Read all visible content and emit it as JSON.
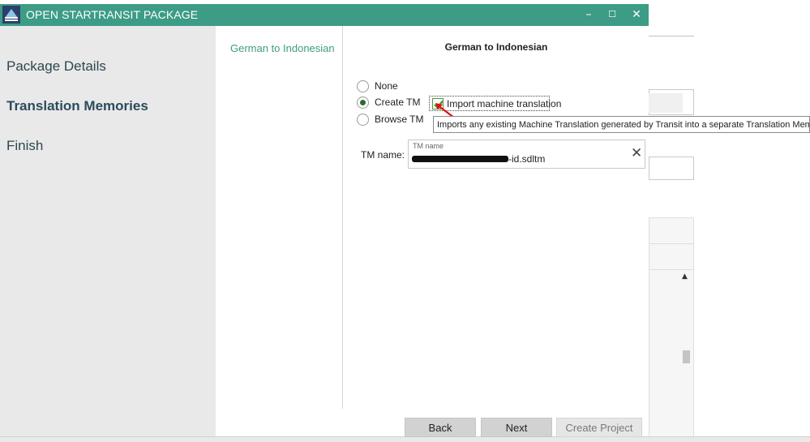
{
  "window": {
    "title": "OPEN STARTRANSIT PACKAGE",
    "minimize_glyph": "–",
    "maximize_glyph": "☐",
    "close_glyph": "✕"
  },
  "sidebar": {
    "items": [
      {
        "label": "Package Details",
        "active": false
      },
      {
        "label": "Translation Memories",
        "active": true
      },
      {
        "label": "Finish",
        "active": false
      }
    ]
  },
  "language_pairs": {
    "items": [
      "German  to Indonesian"
    ]
  },
  "content": {
    "title": "German  to Indonesian",
    "options": {
      "none": "None",
      "create": "Create TM",
      "browse": "Browse TM",
      "selected": "Create TM"
    },
    "import_mt": {
      "label": "Import machine translation",
      "checked": true,
      "tooltip": "Imports any existing Machine Translation generated by Transit into a separate Translation Memory"
    },
    "tm_name": {
      "label": "TM name:",
      "floating_label": "TM name",
      "value": "-id.sdltm",
      "clear_glyph": "✕"
    }
  },
  "buttons": {
    "back": "Back",
    "next": "Next",
    "create_project": "Create Project"
  },
  "colors": {
    "titlebar": "#3d9c85",
    "accent": "#3d9c85",
    "checkmark": "#4a9a3c",
    "arrow": "#e01010"
  },
  "icons": {
    "app": "app-logo-icon",
    "scroll": "scroll-up-arrow-icon"
  }
}
